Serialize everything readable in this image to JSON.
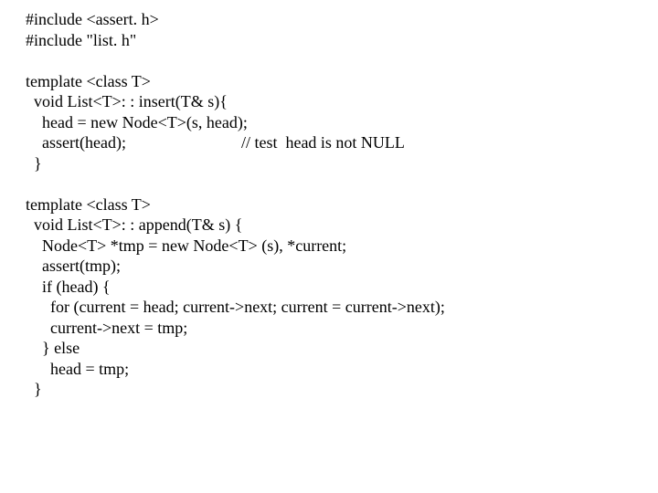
{
  "code": {
    "l01": "#include <assert. h>",
    "l02": "#include \"list. h\"",
    "l03": "",
    "l04": "template <class T>",
    "l05": "  void List<T>: : insert(T& s){",
    "l06": "    head = new Node<T>(s, head);",
    "l07": "    assert(head);                            // test  head is not NULL",
    "l08": "  }",
    "l09": "",
    "l10": "template <class T>",
    "l11": "  void List<T>: : append(T& s) {",
    "l12": "    Node<T> *tmp = new Node<T> (s), *current;",
    "l13": "    assert(tmp);",
    "l14": "    if (head) {",
    "l15": "      for (current = head; current->next; current = current->next);",
    "l16": "      current->next = tmp;",
    "l17": "    } else",
    "l18": "      head = tmp;",
    "l19": "  }"
  }
}
